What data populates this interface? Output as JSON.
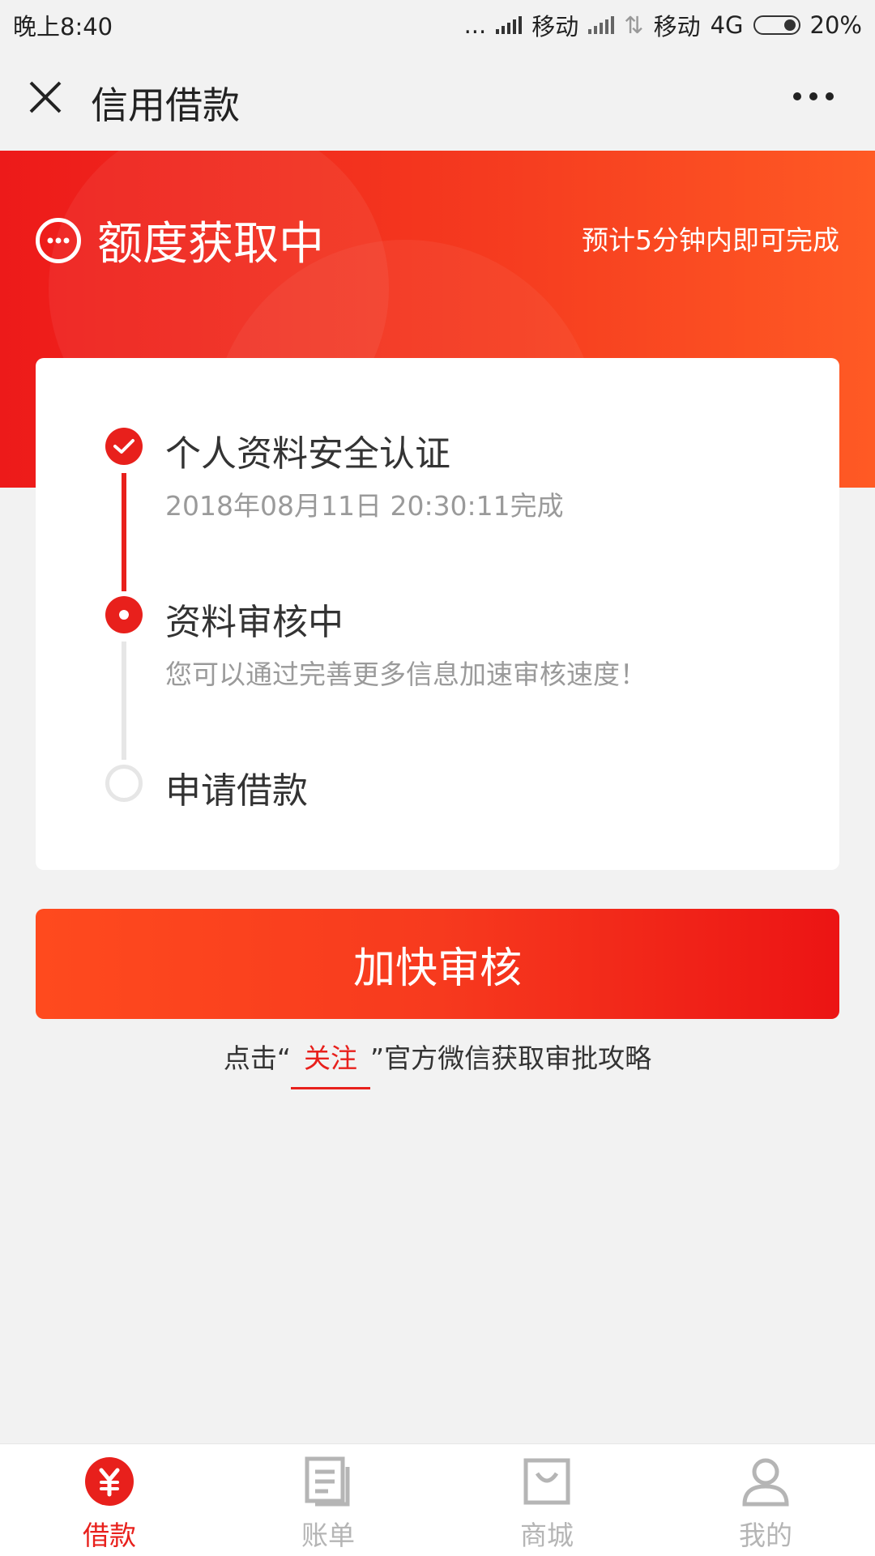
{
  "status_bar": {
    "time": "晚上8:40",
    "dots": "...",
    "carrier1": "移动",
    "carrier2": "移动",
    "network": "4G",
    "battery": "20%"
  },
  "header": {
    "title": "信用借款"
  },
  "banner": {
    "status_title": "额度获取中",
    "eta": "预计5分钟内即可完成"
  },
  "steps": [
    {
      "label": "个人资料安全认证",
      "sub": "2018年08月11日 20:30:11完成"
    },
    {
      "label": "资料审核中",
      "sub": "您可以通过完善更多信息加速审核速度！"
    },
    {
      "label": "申请借款",
      "sub": ""
    }
  ],
  "cta": {
    "label": "加快审核"
  },
  "follow": {
    "prefix": "点击“",
    "link": "关注",
    "suffix": "”官方微信获取审批攻略"
  },
  "tabs": [
    {
      "label": "借款",
      "icon": "yuan-icon"
    },
    {
      "label": "账单",
      "icon": "bill-icon"
    },
    {
      "label": "商城",
      "icon": "shopping-bag-icon"
    },
    {
      "label": "我的",
      "icon": "user-icon"
    }
  ],
  "colors": {
    "accent": "#e8201c",
    "inactive": "#b5b5b5"
  }
}
